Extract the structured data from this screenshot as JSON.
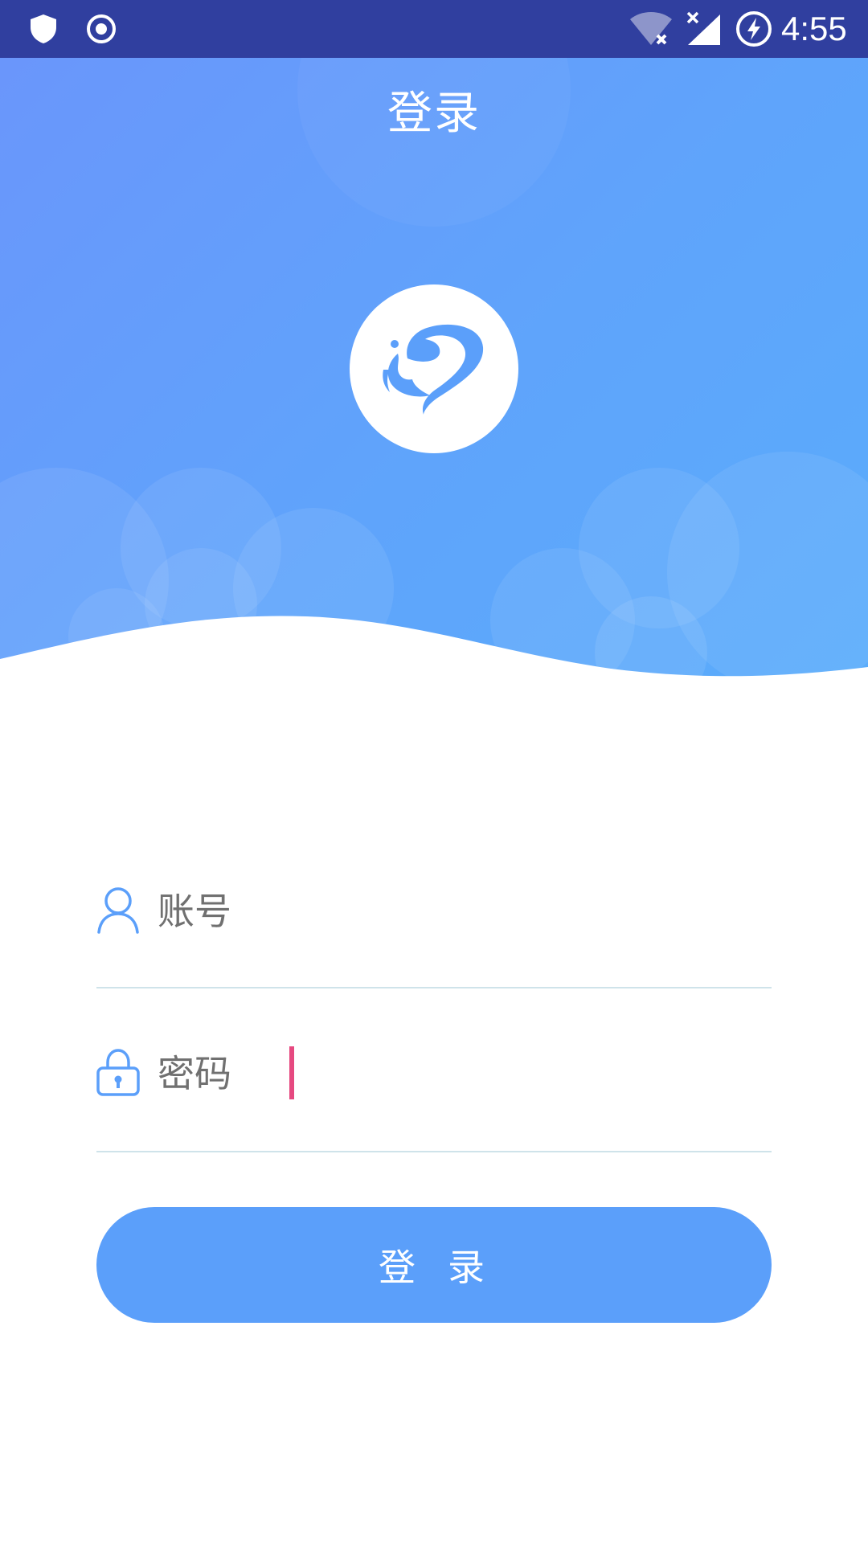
{
  "status_bar": {
    "time": "4:55",
    "icons": [
      "shield-icon",
      "record-icon",
      "wifi-off-icon",
      "signal-off-icon",
      "battery-charging-icon"
    ],
    "background": "#303f9f"
  },
  "header": {
    "title": "登录",
    "logo": "swan-logo-icon",
    "gradient": [
      "#6a96fb",
      "#5aacfb"
    ]
  },
  "form": {
    "account": {
      "icon": "user-icon",
      "label": "账号",
      "value": "",
      "placeholder": ""
    },
    "password": {
      "icon": "lock-icon",
      "label": "密码",
      "value": "",
      "placeholder": ""
    },
    "submit_label": "登录"
  },
  "colors": {
    "accent": "#5b9ffa",
    "icon": "#5b9ffa",
    "label": "#707070",
    "divider": "#cfe3ea",
    "caret": "#e64980"
  }
}
